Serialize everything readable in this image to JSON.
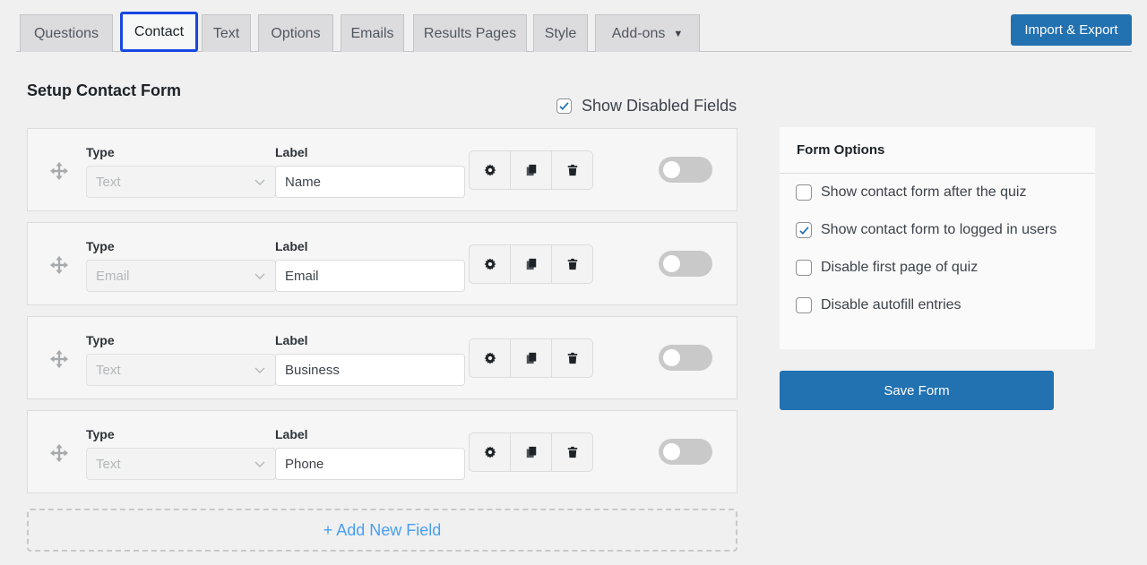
{
  "tabs": [
    {
      "label": "Questions",
      "active": false
    },
    {
      "label": "Contact",
      "active": true
    },
    {
      "label": "Text",
      "active": false
    },
    {
      "label": "Options",
      "active": false
    },
    {
      "label": "Emails",
      "active": false
    },
    {
      "label": "Results Pages",
      "active": false
    },
    {
      "label": "Style",
      "active": false
    },
    {
      "label": "Add-ons",
      "active": false,
      "has_dropdown": true
    }
  ],
  "import_export_label": "Import & Export",
  "section_title": "Setup Contact Form",
  "show_disabled": {
    "label": "Show Disabled Fields",
    "checked": true
  },
  "field_headers": {
    "type": "Type",
    "label": "Label"
  },
  "fields": [
    {
      "type": "Text",
      "label": "Name",
      "enabled": false
    },
    {
      "type": "Email",
      "label": "Email",
      "enabled": false
    },
    {
      "type": "Text",
      "label": "Business",
      "enabled": false
    },
    {
      "type": "Text",
      "label": "Phone",
      "enabled": false
    }
  ],
  "field_actions": [
    "settings-icon",
    "duplicate-icon",
    "delete-icon"
  ],
  "add_field_label": "+ Add New Field",
  "form_options": {
    "title": "Form Options",
    "items": [
      {
        "label": "Show contact form after the quiz",
        "checked": false
      },
      {
        "label": "Show contact form to logged in users",
        "checked": true
      },
      {
        "label": "Disable first page of quiz",
        "checked": false
      },
      {
        "label": "Disable autofill entries",
        "checked": false
      }
    ]
  },
  "save_label": "Save Form",
  "colors": {
    "accent": "#2271b1",
    "active_tab_border": "#1747e0",
    "add_link": "#4a9ff0"
  }
}
